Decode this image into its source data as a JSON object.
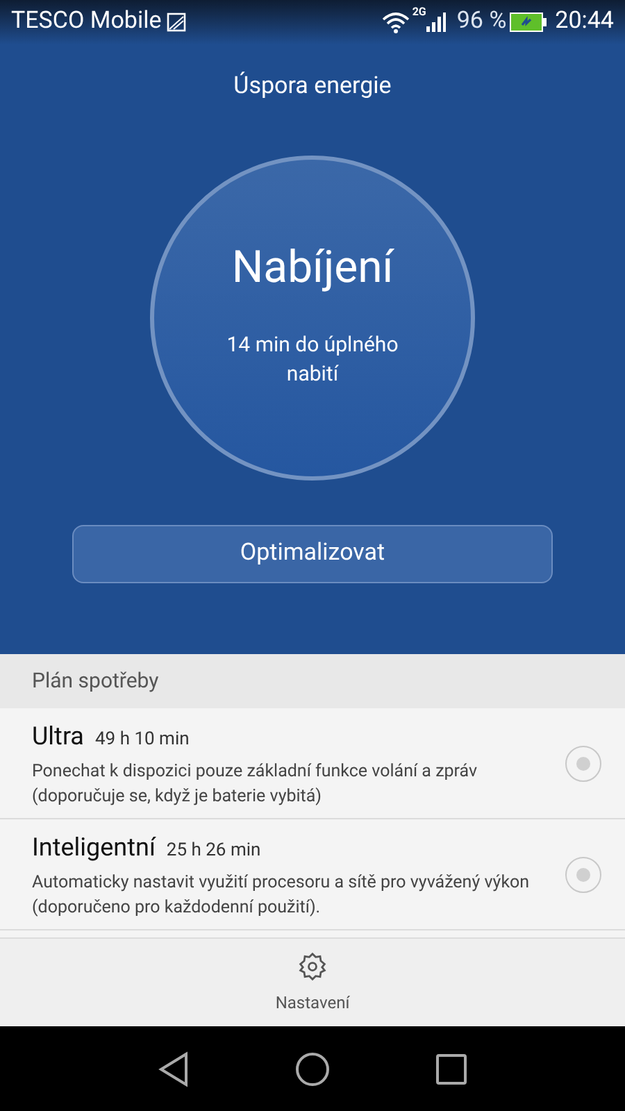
{
  "status_bar": {
    "carrier": "TESCO Mobile",
    "network": "2G",
    "battery": "96 %",
    "time": "20:44"
  },
  "title": "Úspora energie",
  "status_circle": {
    "heading": "Nabíjení",
    "subtitle": "14 min do úplného nabití"
  },
  "optimize_button": "Optimalizovat",
  "plan_section": {
    "title": "Plán spotřeby",
    "plans": [
      {
        "name": "Ultra",
        "duration": "49 h 10 min",
        "description": "Ponechat k dispozici pouze základní funkce volání a zpráv (doporučuje se, když je baterie vybitá)",
        "selected": false
      },
      {
        "name": "Inteligentní",
        "duration": "25 h 26 min",
        "description": "Automaticky nastavit využití procesoru a sítě pro vyvážený výkon (doporučeno pro každodenní použití).",
        "selected": false
      }
    ]
  },
  "bottom_action": {
    "label": "Nastavení"
  }
}
